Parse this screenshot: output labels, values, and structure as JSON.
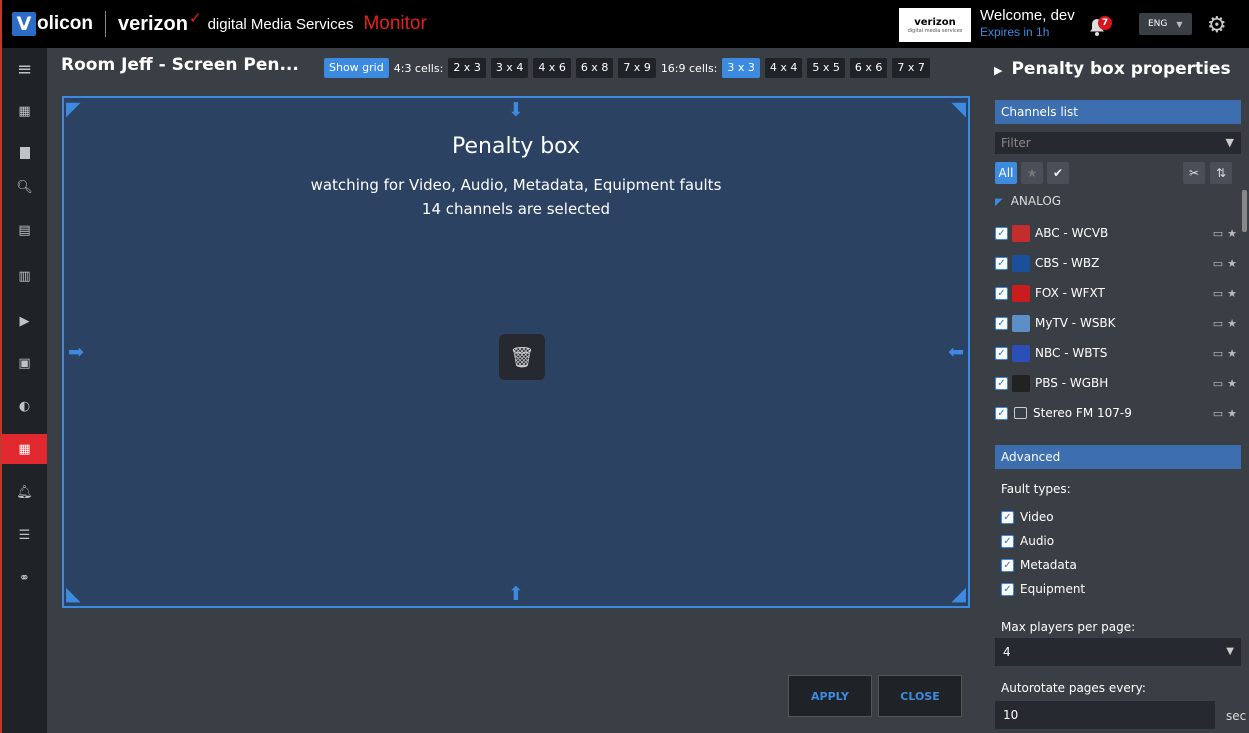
{
  "header": {
    "logo_v": "V",
    "logo_rest": "olicon",
    "brand": "verizon",
    "brand_sub": "digital Media Services",
    "app_name": "Monitor",
    "card_brand": "verizon",
    "card_sub": "digital media services",
    "welcome": "Welcome, dev",
    "expires": "Expires in 1h",
    "notifications": "7",
    "language": "ENG"
  },
  "sidebar": {
    "active_item": "grid-view"
  },
  "toolbar": {
    "room_title": "Room Jeff - Screen Pen...",
    "show_grid": "Show grid",
    "label_43": "4:3 cells:",
    "cells_43": [
      "2 x 3",
      "3 x 4",
      "4 x 6",
      "6 x 8",
      "7 x 9"
    ],
    "label_169": "16:9 cells:",
    "cells_169": [
      "3 x 3",
      "4 x 4",
      "5 x 5",
      "6 x 6",
      "7 x 7"
    ],
    "selected_169": "3 x 3"
  },
  "canvas": {
    "title": "Penalty box",
    "subtitle": "watching for Video, Audio, Metadata, Equipment faults",
    "count": "14 channels are selected"
  },
  "actions": {
    "apply": "APPLY",
    "close": "CLOSE"
  },
  "panel": {
    "title": "Penalty box properties",
    "channels_header": "Channels list",
    "filter_placeholder": "Filter",
    "filter_all": "All",
    "group": "ANALOG",
    "channels": [
      {
        "name": "ABC - WCVB",
        "checked": true
      },
      {
        "name": "CBS - WBZ",
        "checked": true
      },
      {
        "name": "FOX - WFXT",
        "checked": true
      },
      {
        "name": "MyTV - WSBK",
        "checked": true
      },
      {
        "name": "NBC - WBTS",
        "checked": true
      },
      {
        "name": "PBS - WGBH",
        "checked": true
      },
      {
        "name": "Stereo FM 107-9",
        "checked": true
      }
    ],
    "advanced_header": "Advanced",
    "fault_types_label": "Fault types:",
    "fault_types": [
      "Video",
      "Audio",
      "Metadata",
      "Equipment"
    ],
    "max_players_label": "Max players per page:",
    "max_players_value": "4",
    "autorotate_label": "Autorotate pages every:",
    "autorotate_value": "10",
    "autorotate_unit": "sec"
  },
  "colors": {
    "accent": "#3d8be0",
    "brand_red": "#e2231a",
    "active_nav": "#e0282e",
    "canvas_bg": "#2b4263"
  }
}
